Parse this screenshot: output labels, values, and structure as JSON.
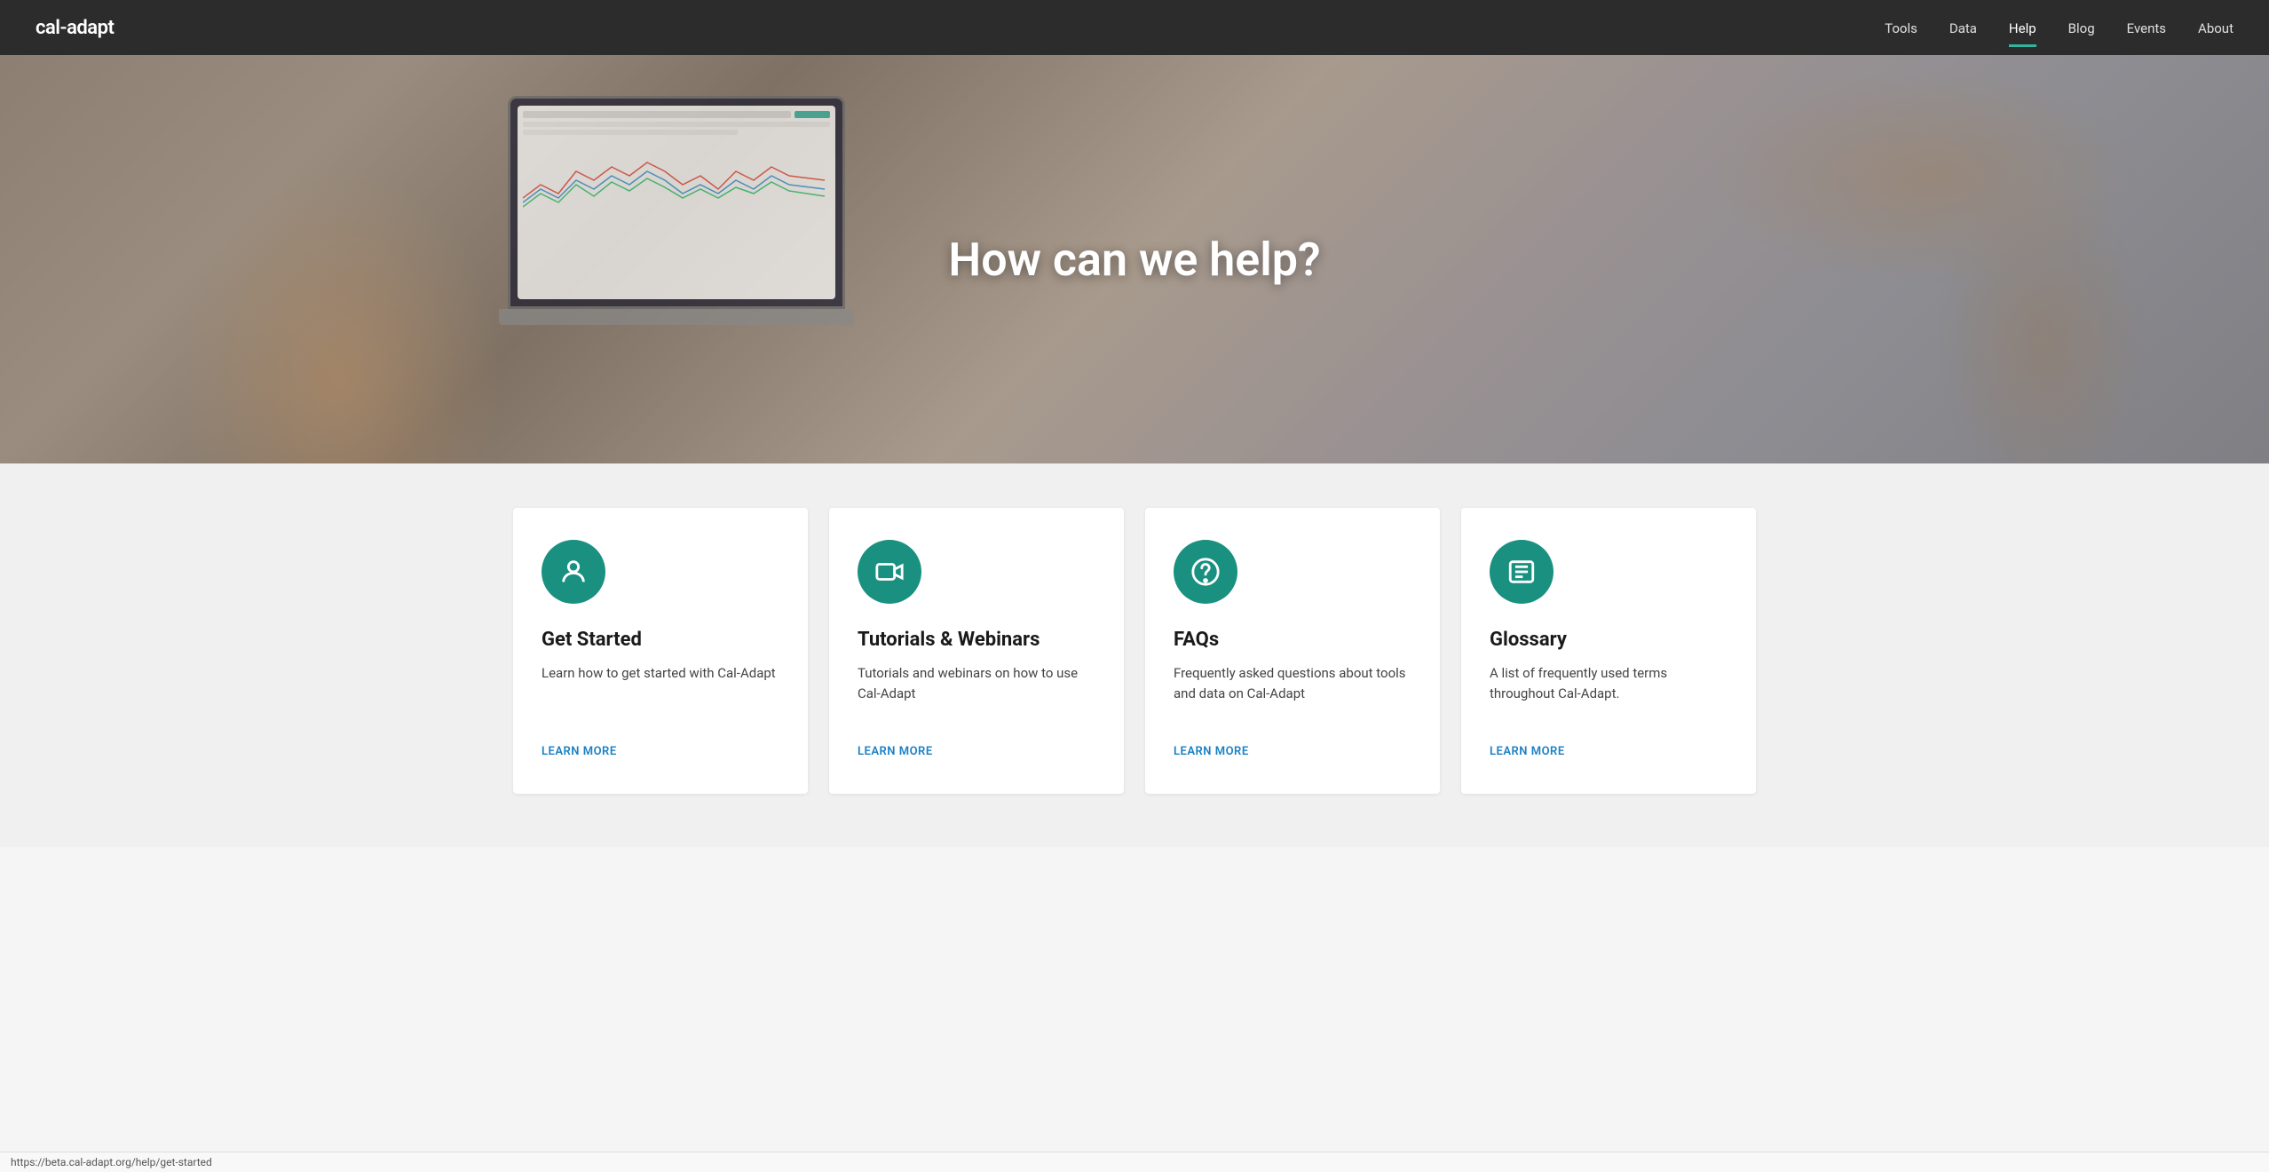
{
  "logo": {
    "text": "cal-adapt"
  },
  "nav": {
    "links": [
      {
        "label": "Tools",
        "active": false
      },
      {
        "label": "Data",
        "active": false
      },
      {
        "label": "Help",
        "active": true
      },
      {
        "label": "Blog",
        "active": false
      },
      {
        "label": "Events",
        "active": false
      },
      {
        "label": "About",
        "active": false
      }
    ]
  },
  "hero": {
    "heading": "How can we help?"
  },
  "cards": [
    {
      "icon": "person",
      "title": "Get Started",
      "desc": "Learn how to get started with Cal-Adapt",
      "link_label": "LEARN MORE",
      "link_url": "https://beta.cal-adapt.org/help/get-started"
    },
    {
      "icon": "video",
      "title": "Tutorials & Webinars",
      "desc": "Tutorials and webinars on how to use Cal-Adapt",
      "link_label": "LEARN MORE",
      "link_url": "#"
    },
    {
      "icon": "question",
      "title": "FAQs",
      "desc": "Frequently asked questions about tools and data on Cal-Adapt",
      "link_label": "LEARN MORE",
      "link_url": "#"
    },
    {
      "icon": "list",
      "title": "Glossary",
      "desc": "A list of frequently used terms throughout Cal-Adapt.",
      "link_label": "LEARN MORE",
      "link_url": "#"
    }
  ],
  "status_bar": {
    "url": "https://beta.cal-adapt.org/help/get-started"
  }
}
